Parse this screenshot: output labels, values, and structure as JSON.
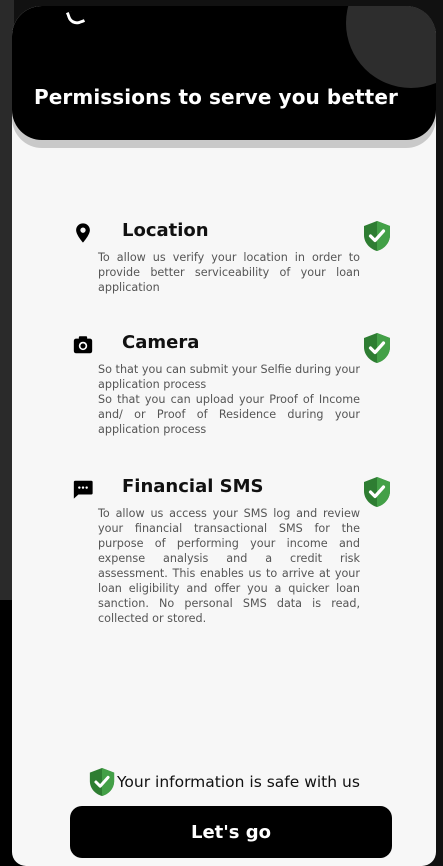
{
  "header": {
    "title": "Permissions to serve you better"
  },
  "permissions": [
    {
      "icon": "location-pin-icon",
      "title": "Location",
      "description": [
        "To allow us verify your location in order to provide better serviceability of your loan application"
      ],
      "status_icon": "shield-check-icon"
    },
    {
      "icon": "camera-icon",
      "title": "Camera",
      "description": [
        "So that you can submit your Selfie during your application process",
        "So that you can upload your Proof of Income and/ or Proof of Residence during your application process"
      ],
      "status_icon": "shield-check-icon"
    },
    {
      "icon": "sms-chat-icon",
      "title": "Financial SMS",
      "description": [
        "To allow us access your SMS log and review your financial transactional SMS for the purpose of performing your income and expense analysis and a credit risk assessment. This enables us to arrive at your loan eligibility and offer you a quicker loan sanction. No personal SMS data is read, collected or stored."
      ],
      "status_icon": "shield-check-icon"
    }
  ],
  "footer": {
    "safe_text": "Your information is safe with us",
    "cta_label": "Let's go"
  },
  "colors": {
    "header_bg": "#000000",
    "page_bg": "#f7f7f7",
    "shield_green": "#2e7d32",
    "cta_bg": "#000000"
  }
}
